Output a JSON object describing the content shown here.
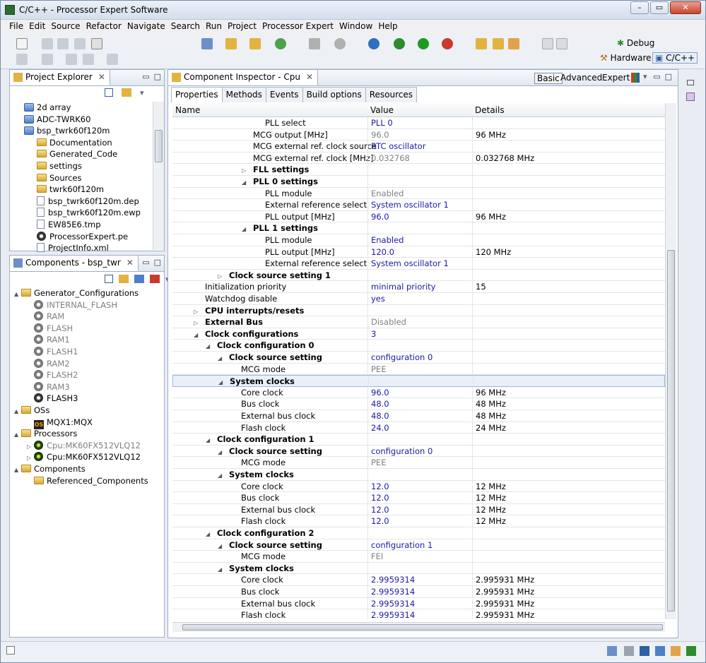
{
  "window": {
    "title": "C/C++ - Processor Expert Software"
  },
  "menu": [
    "File",
    "Edit",
    "Source",
    "Refactor",
    "Navigate",
    "Search",
    "Run",
    "Project",
    "Processor Expert",
    "Window",
    "Help"
  ],
  "perspectives": {
    "debug": "Debug",
    "hardware": "Hardware",
    "cpp": "C/C++"
  },
  "project_explorer": {
    "tab_label": "Project Explorer",
    "items": [
      {
        "label": "2d array",
        "icon": "project"
      },
      {
        "label": "ADC-TWRK60",
        "icon": "project"
      },
      {
        "label": "bsp_twrk60f120m",
        "icon": "project"
      },
      {
        "label": "Documentation",
        "icon": "folder"
      },
      {
        "label": "Generated_Code",
        "icon": "folder"
      },
      {
        "label": "settings",
        "icon": "folder"
      },
      {
        "label": "Sources",
        "icon": "folder"
      },
      {
        "label": "twrk60f120m",
        "icon": "folder"
      },
      {
        "label": "bsp_twrk60f120m.dep",
        "icon": "file"
      },
      {
        "label": "bsp_twrk60f120m.ewp",
        "icon": "file"
      },
      {
        "label": "EW85E6.tmp",
        "icon": "file"
      },
      {
        "label": "ProcessorExpert.pe",
        "icon": "pe"
      },
      {
        "label": "ProjectInfo.xml",
        "icon": "file"
      }
    ]
  },
  "components": {
    "tab_label": "Components - bsp_twr",
    "items": [
      {
        "label": "Generator_Configurations",
        "icon": "folder",
        "level": 0,
        "arrow": "▲",
        "style": "normal"
      },
      {
        "label": "INTERNAL_FLASH",
        "icon": "gear",
        "level": 1,
        "arrow": "",
        "style": "gray"
      },
      {
        "label": "RAM",
        "icon": "gear",
        "level": 1,
        "arrow": "",
        "style": "gray"
      },
      {
        "label": "FLASH",
        "icon": "gear",
        "level": 1,
        "arrow": "",
        "style": "gray"
      },
      {
        "label": "RAM1",
        "icon": "gear",
        "level": 1,
        "arrow": "",
        "style": "gray"
      },
      {
        "label": "FLASH1",
        "icon": "gear",
        "level": 1,
        "arrow": "",
        "style": "gray"
      },
      {
        "label": "RAM2",
        "icon": "gear",
        "level": 1,
        "arrow": "",
        "style": "gray"
      },
      {
        "label": "FLASH2",
        "icon": "gear",
        "level": 1,
        "arrow": "",
        "style": "gray"
      },
      {
        "label": "RAM3",
        "icon": "gear",
        "level": 1,
        "arrow": "",
        "style": "gray"
      },
      {
        "label": "FLASH3",
        "icon": "gear-dark",
        "level": 1,
        "arrow": "",
        "style": "normal"
      },
      {
        "label": "OSs",
        "icon": "folder",
        "level": 0,
        "arrow": "▲",
        "style": "normal"
      },
      {
        "label": "MQX1:MQX",
        "icon": "os",
        "level": 1,
        "arrow": "",
        "style": "normal"
      },
      {
        "label": "Processors",
        "icon": "folder",
        "level": 0,
        "arrow": "▲",
        "style": "normal"
      },
      {
        "label": "Cpu:MK60FX512VLQ12",
        "icon": "chip",
        "level": 1,
        "arrow": "▷",
        "style": "gray"
      },
      {
        "label": "Cpu:MK60FX512VLQ12",
        "icon": "chip",
        "level": 1,
        "arrow": "▷",
        "style": "normal"
      },
      {
        "label": "Components",
        "icon": "folder",
        "level": 0,
        "arrow": "▲",
        "style": "normal"
      },
      {
        "label": "Referenced_Components",
        "icon": "folder",
        "level": 1,
        "arrow": "",
        "style": "normal"
      }
    ]
  },
  "inspector": {
    "tab_label": "Component Inspector - Cpu",
    "modes": {
      "basic": "Basic",
      "advanced": "Advanced",
      "expert": "Expert"
    },
    "subtabs": [
      "Properties",
      "Methods",
      "Events",
      "Build options",
      "Resources"
    ],
    "columns": {
      "name": "Name",
      "value": "Value",
      "details": "Details"
    },
    "rows": [
      {
        "n": "PLL select",
        "v": "PLL 0",
        "d": "",
        "lvl": 7,
        "b": 0,
        "vc": "blue",
        "a": ""
      },
      {
        "n": "MCG output [MHz]",
        "v": "96.0",
        "d": "96 MHz",
        "lvl": 6,
        "b": 0,
        "vc": "gray",
        "a": ""
      },
      {
        "n": "MCG external ref. clock source",
        "v": "RTC oscillator",
        "d": "",
        "lvl": 6,
        "b": 0,
        "vc": "blue",
        "a": ""
      },
      {
        "n": "MCG external ref. clock [MHz]",
        "v": "0.032768",
        "d": "0.032768 MHz",
        "lvl": 6,
        "b": 0,
        "vc": "gray",
        "a": ""
      },
      {
        "n": "FLL settings",
        "v": "",
        "d": "",
        "lvl": 6,
        "b": 1,
        "vc": "",
        "a": "▷"
      },
      {
        "n": "PLL 0 settings",
        "v": "",
        "d": "",
        "lvl": 6,
        "b": 1,
        "vc": "",
        "a": "◢"
      },
      {
        "n": "PLL module",
        "v": "Enabled",
        "d": "",
        "lvl": 7,
        "b": 0,
        "vc": "gray",
        "a": ""
      },
      {
        "n": "External reference select",
        "v": "System oscillator 1",
        "d": "",
        "lvl": 7,
        "b": 0,
        "vc": "blue",
        "a": ""
      },
      {
        "n": "PLL output [MHz]",
        "v": "96.0",
        "d": "96 MHz",
        "lvl": 7,
        "b": 0,
        "vc": "blue",
        "a": ""
      },
      {
        "n": "PLL 1 settings",
        "v": "",
        "d": "",
        "lvl": 6,
        "b": 1,
        "vc": "",
        "a": "◢"
      },
      {
        "n": "PLL module",
        "v": "Enabled",
        "d": "",
        "lvl": 7,
        "b": 0,
        "vc": "blue",
        "a": ""
      },
      {
        "n": "PLL output [MHz]",
        "v": "120.0",
        "d": "120 MHz",
        "lvl": 7,
        "b": 0,
        "vc": "blue",
        "a": ""
      },
      {
        "n": "External reference select",
        "v": "System oscillator 1",
        "d": "",
        "lvl": 7,
        "b": 0,
        "vc": "blue",
        "a": ""
      },
      {
        "n": "Clock source setting 1",
        "v": "",
        "d": "",
        "lvl": 4,
        "b": 1,
        "vc": "",
        "a": "▷"
      },
      {
        "n": "Initialization priority",
        "v": "minimal priority",
        "d": "15",
        "lvl": 2,
        "b": 0,
        "vc": "blue",
        "a": ""
      },
      {
        "n": "Watchdog disable",
        "v": "yes",
        "d": "",
        "lvl": 2,
        "b": 0,
        "vc": "blue",
        "a": ""
      },
      {
        "n": "CPU interrupts/resets",
        "v": "",
        "d": "",
        "lvl": 2,
        "b": 1,
        "vc": "",
        "a": "▷"
      },
      {
        "n": "External Bus",
        "v": "Disabled",
        "d": "",
        "lvl": 2,
        "b": 1,
        "vc": "gray",
        "a": "▷"
      },
      {
        "n": "Clock configurations",
        "v": "3",
        "d": "",
        "lvl": 2,
        "b": 1,
        "vc": "blue",
        "a": "◢"
      },
      {
        "n": "Clock configuration 0",
        "v": "",
        "d": "",
        "lvl": 3,
        "b": 1,
        "vc": "",
        "a": "◢"
      },
      {
        "n": "Clock source setting",
        "v": "configuration 0",
        "d": "",
        "lvl": 4,
        "b": 1,
        "vc": "blue",
        "a": "◢"
      },
      {
        "n": "MCG mode",
        "v": "PEE",
        "d": "",
        "lvl": 5,
        "b": 0,
        "vc": "gray",
        "a": ""
      },
      {
        "n": "System clocks",
        "v": "",
        "d": "",
        "lvl": 4,
        "b": 1,
        "vc": "",
        "a": "◢",
        "sel": 1
      },
      {
        "n": "Core clock",
        "v": "96.0",
        "d": "96 MHz",
        "lvl": 5,
        "b": 0,
        "vc": "blue",
        "a": ""
      },
      {
        "n": "Bus clock",
        "v": "48.0",
        "d": "48 MHz",
        "lvl": 5,
        "b": 0,
        "vc": "blue",
        "a": ""
      },
      {
        "n": "External bus clock",
        "v": "48.0",
        "d": "48 MHz",
        "lvl": 5,
        "b": 0,
        "vc": "blue",
        "a": ""
      },
      {
        "n": "Flash clock",
        "v": "24.0",
        "d": "24 MHz",
        "lvl": 5,
        "b": 0,
        "vc": "blue",
        "a": ""
      },
      {
        "n": "Clock configuration 1",
        "v": "",
        "d": "",
        "lvl": 3,
        "b": 1,
        "vc": "",
        "a": "◢"
      },
      {
        "n": "Clock source setting",
        "v": "configuration 0",
        "d": "",
        "lvl": 4,
        "b": 1,
        "vc": "blue",
        "a": "◢"
      },
      {
        "n": "MCG mode",
        "v": "PEE",
        "d": "",
        "lvl": 5,
        "b": 0,
        "vc": "gray",
        "a": ""
      },
      {
        "n": "System clocks",
        "v": "",
        "d": "",
        "lvl": 4,
        "b": 1,
        "vc": "",
        "a": "◢"
      },
      {
        "n": "Core clock",
        "v": "12.0",
        "d": "12 MHz",
        "lvl": 5,
        "b": 0,
        "vc": "blue",
        "a": ""
      },
      {
        "n": "Bus clock",
        "v": "12.0",
        "d": "12 MHz",
        "lvl": 5,
        "b": 0,
        "vc": "blue",
        "a": ""
      },
      {
        "n": "External bus clock",
        "v": "12.0",
        "d": "12 MHz",
        "lvl": 5,
        "b": 0,
        "vc": "blue",
        "a": ""
      },
      {
        "n": "Flash clock",
        "v": "12.0",
        "d": "12 MHz",
        "lvl": 5,
        "b": 0,
        "vc": "blue",
        "a": ""
      },
      {
        "n": "Clock configuration 2",
        "v": "",
        "d": "",
        "lvl": 3,
        "b": 1,
        "vc": "",
        "a": "◢"
      },
      {
        "n": "Clock source setting",
        "v": "configuration 1",
        "d": "",
        "lvl": 4,
        "b": 1,
        "vc": "blue",
        "a": "◢"
      },
      {
        "n": "MCG mode",
        "v": "FEI",
        "d": "",
        "lvl": 5,
        "b": 0,
        "vc": "gray",
        "a": ""
      },
      {
        "n": "System clocks",
        "v": "",
        "d": "",
        "lvl": 4,
        "b": 1,
        "vc": "",
        "a": "◢"
      },
      {
        "n": "Core clock",
        "v": "2.9959314",
        "d": "2.995931 MHz",
        "lvl": 5,
        "b": 0,
        "vc": "blue",
        "a": ""
      },
      {
        "n": "Bus clock",
        "v": "2.9959314",
        "d": "2.995931 MHz",
        "lvl": 5,
        "b": 0,
        "vc": "blue",
        "a": ""
      },
      {
        "n": "External bus clock",
        "v": "2.9959314",
        "d": "2.995931 MHz",
        "lvl": 5,
        "b": 0,
        "vc": "blue",
        "a": ""
      },
      {
        "n": "Flash clock",
        "v": "2.9959314",
        "d": "2.995931 MHz",
        "lvl": 5,
        "b": 0,
        "vc": "blue",
        "a": ""
      }
    ]
  }
}
